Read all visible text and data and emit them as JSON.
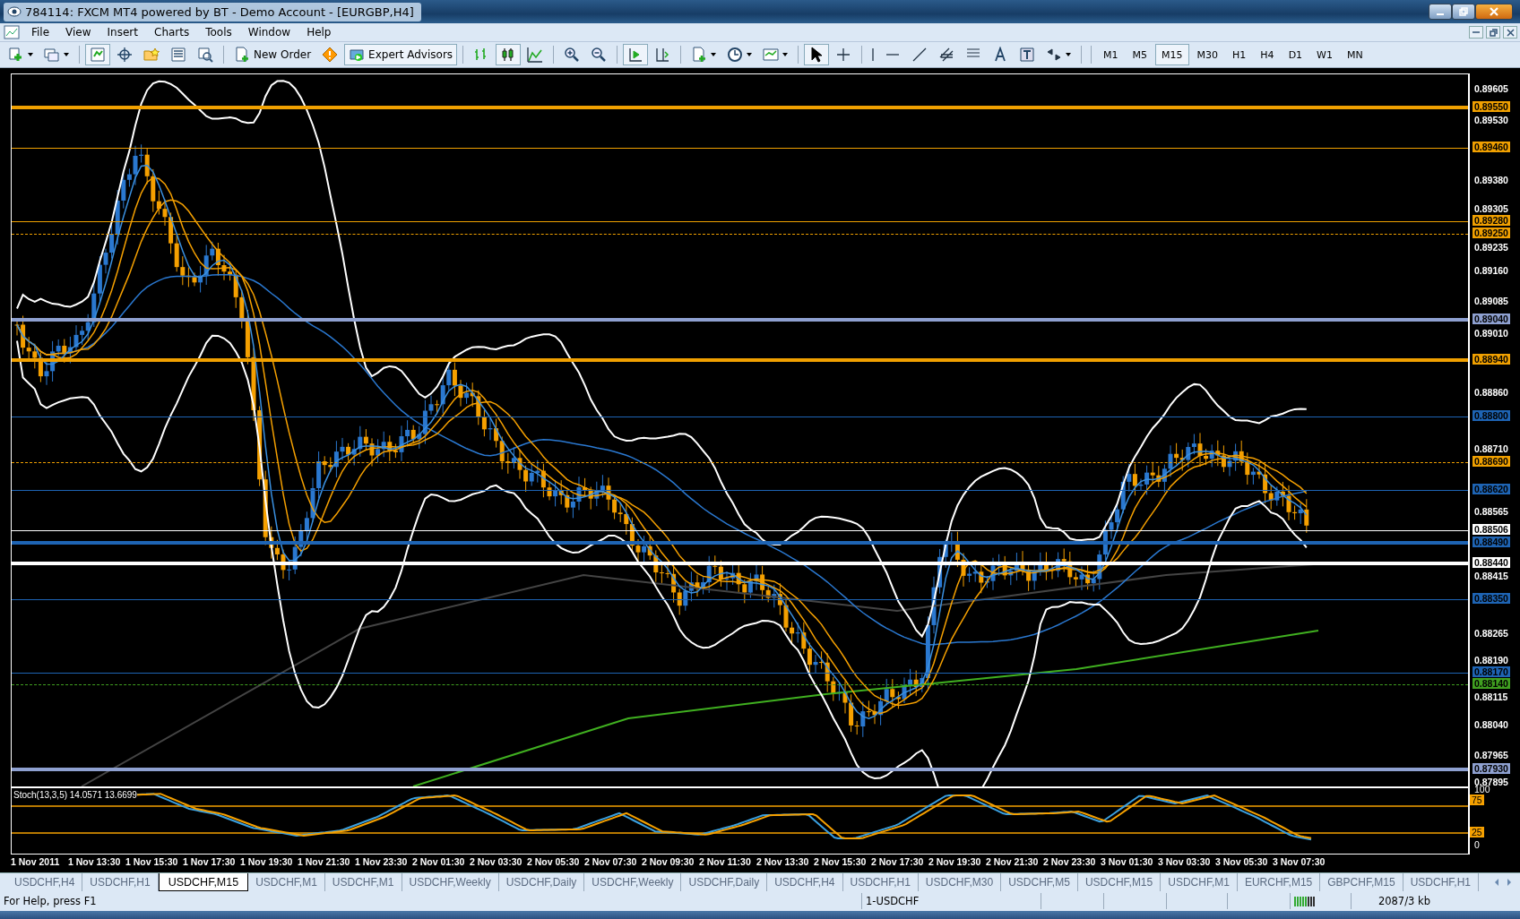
{
  "window": {
    "title": "784114: FXCM MT4 powered by BT - Demo Account - [EURGBP,H4]"
  },
  "menu": [
    "File",
    "View",
    "Insert",
    "Charts",
    "Tools",
    "Window",
    "Help"
  ],
  "toolbar": {
    "buttons": [
      "New Order",
      "Expert Advisors"
    ],
    "timeframes": [
      {
        "label": "M1",
        "selected": false
      },
      {
        "label": "M5",
        "selected": false
      },
      {
        "label": "M15",
        "selected": true
      },
      {
        "label": "M30",
        "selected": false
      },
      {
        "label": "H1",
        "selected": false
      },
      {
        "label": "H4",
        "selected": false
      },
      {
        "label": "D1",
        "selected": false
      },
      {
        "label": "W1",
        "selected": false
      },
      {
        "label": "MN",
        "selected": false
      }
    ]
  },
  "chart": {
    "price_ticks": [
      "0.89605",
      "0.89530",
      "0.89380",
      "0.89305",
      "0.89235",
      "0.89160",
      "0.89085",
      "0.89010",
      "0.88860",
      "0.88710",
      "0.88565",
      "0.88415",
      "0.88265",
      "0.88190",
      "0.88115",
      "0.88040",
      "0.87965",
      "0.87895"
    ],
    "levels": [
      {
        "label": "0.89550",
        "color": "#f0a000",
        "kind": "thick"
      },
      {
        "label": "0.89460",
        "color": "#f0a000",
        "kind": "solid"
      },
      {
        "label": "0.89280",
        "color": "#f0a000",
        "kind": "solid"
      },
      {
        "label": "0.89250",
        "color": "#f0a000",
        "kind": "dashed"
      },
      {
        "label": "0.89040",
        "color": "#8ea0d0",
        "kind": "thick"
      },
      {
        "label": "0.88940",
        "color": "#f0a000",
        "kind": "thick"
      },
      {
        "label": "0.88800",
        "color": "#1e64b4",
        "kind": "solid"
      },
      {
        "label": "0.88690",
        "color": "#f0a000",
        "kind": "dashed"
      },
      {
        "label": "0.88620",
        "color": "#1e64b4",
        "kind": "solid"
      },
      {
        "label": "0.88506",
        "color": "#ffffff",
        "kind": "solid"
      },
      {
        "label": "0.88490",
        "color": "#1e64b4",
        "kind": "thick"
      },
      {
        "label": "0.88440",
        "color": "#ffffff",
        "kind": "thick"
      },
      {
        "label": "0.88350",
        "color": "#1e64b4",
        "kind": "solid"
      },
      {
        "label": "0.88170",
        "color": "#1e64b4",
        "kind": "solid"
      },
      {
        "label": "0.88140",
        "color": "#40a020",
        "kind": "dashed"
      },
      {
        "label": "0.87930",
        "color": "#8ea0d0",
        "kind": "thick"
      }
    ],
    "indicator": {
      "label": "Stoch(13,3,5) 14.0571 13.6699",
      "ticks": [
        "100",
        "75",
        "25",
        "0"
      ]
    },
    "time_labels": [
      "1 Nov 2011",
      "1 Nov 13:30",
      "1 Nov 15:30",
      "1 Nov 17:30",
      "1 Nov 19:30",
      "1 Nov 21:30",
      "1 Nov 23:30",
      "2 Nov 01:30",
      "2 Nov 03:30",
      "2 Nov 05:30",
      "2 Nov 07:30",
      "2 Nov 09:30",
      "2 Nov 11:30",
      "2 Nov 13:30",
      "2 Nov 15:30",
      "2 Nov 17:30",
      "2 Nov 19:30",
      "2 Nov 21:30",
      "2 Nov 23:30",
      "3 Nov 01:30",
      "3 Nov 03:30",
      "3 Nov 05:30",
      "3 Nov 07:30"
    ]
  },
  "tabs": [
    {
      "label": "USDCHF,H4",
      "selected": false
    },
    {
      "label": "USDCHF,H1",
      "selected": false
    },
    {
      "label": "USDCHF,M15",
      "selected": true
    },
    {
      "label": "USDCHF,M1",
      "selected": false
    },
    {
      "label": "USDCHF,M1",
      "selected": false
    },
    {
      "label": "USDCHF,Weekly",
      "selected": false
    },
    {
      "label": "USDCHF,Daily",
      "selected": false
    },
    {
      "label": "USDCHF,Weekly",
      "selected": false
    },
    {
      "label": "USDCHF,Daily",
      "selected": false
    },
    {
      "label": "USDCHF,H4",
      "selected": false
    },
    {
      "label": "USDCHF,H1",
      "selected": false
    },
    {
      "label": "USDCHF,M30",
      "selected": false
    },
    {
      "label": "USDCHF,M5",
      "selected": false
    },
    {
      "label": "USDCHF,M15",
      "selected": false
    },
    {
      "label": "USDCHF,M1",
      "selected": false
    },
    {
      "label": "EURCHF,M15",
      "selected": false
    },
    {
      "label": "GBPCHF,M15",
      "selected": false
    },
    {
      "label": "USDCHF,H1",
      "selected": false
    }
  ],
  "status_bar": {
    "help": "For Help, press F1",
    "profile": "1-USDCHF",
    "traffic": "2087/3 kb"
  }
}
